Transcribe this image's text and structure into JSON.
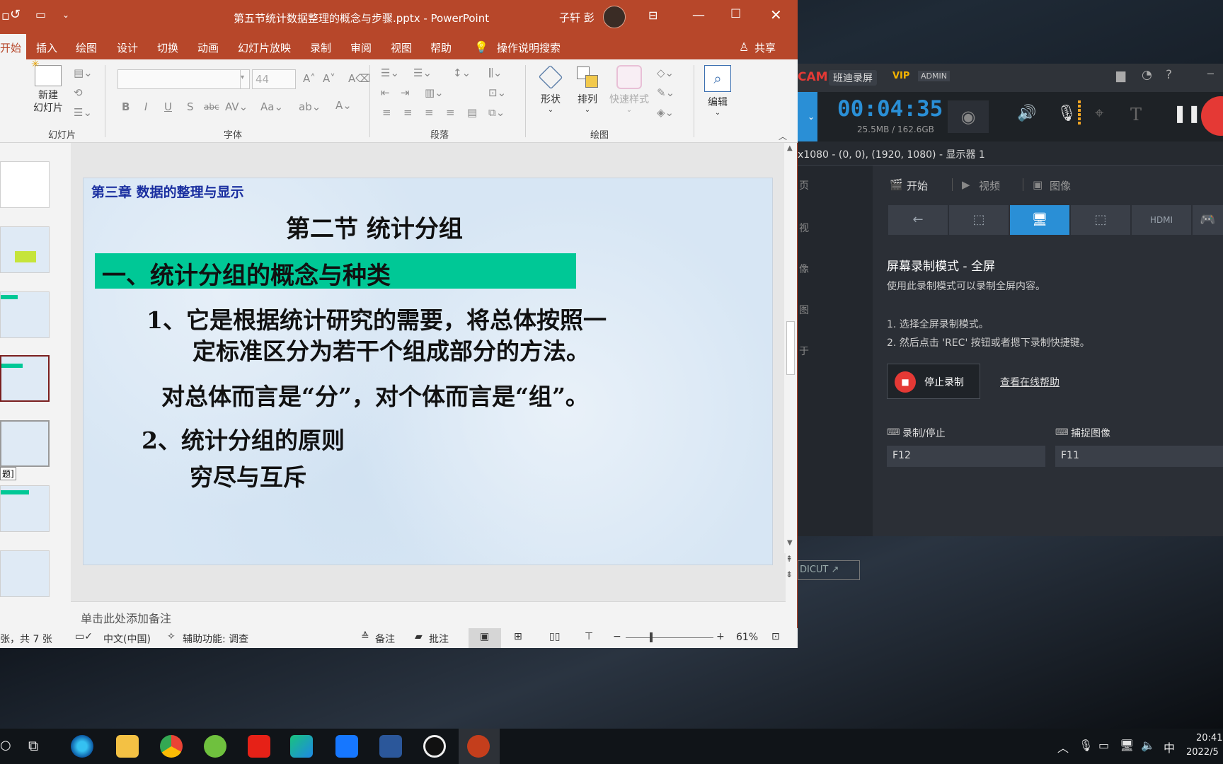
{
  "ppt": {
    "title": "第五节统计数据整理的概念与步骤.pptx  -  PowerPoint",
    "user": "子轩 彭",
    "menu": [
      "开始",
      "插入",
      "绘图",
      "设计",
      "切换",
      "动画",
      "幻灯片放映",
      "录制",
      "审阅",
      "视图",
      "帮助",
      "操作说明搜索",
      "共享"
    ],
    "ribbon": {
      "new_slide": "新建\n幻灯片",
      "slides_group": "幻灯片",
      "font_size": "44",
      "font_group": "字体",
      "para_group": "段落",
      "shape": "形状",
      "arrange": "排列",
      "quick_style": "快速样式",
      "draw_group": "绘图",
      "edit": "编辑"
    },
    "thumb_tag": "题]",
    "slide": {
      "chapter": "第三章  数据的整理与显示",
      "section": "第二节    统计分组",
      "heading": "一、统计分组的概念与种类",
      "p1a": "1、它是根据统计研究的需要，将总体按照一",
      "p1b": "定标准区分为若干个组成部分的方法。",
      "p2": "对总体而言是“分”，对个体而言是“组”。",
      "p3": "2、统计分组的原则",
      "p4": "穷尽与互斥"
    },
    "notes_placeholder": "单击此处添加备注",
    "status": {
      "slide_count": "张，共 7 张",
      "lang": "中文(中国)",
      "access": "辅助功能: 调查",
      "notes": "备注",
      "comments": "批注",
      "zoom": "61%"
    }
  },
  "bandicam": {
    "brand": "CAM",
    "brand_cn": "班迪录屏",
    "vip": "VIP",
    "admin": "ADMIN",
    "timer": "00:04:35",
    "size": "25.5MB / 162.6GB",
    "info": "x1080 - (0, 0), (1920, 1080) - 显示器 1",
    "tabs": [
      "开始",
      "视频",
      "图像"
    ],
    "mode_title": "屏幕录制模式 - 全屏",
    "mode_desc": "使用此录制模式可以录制全屏内容。",
    "step1": "1. 选择全屏录制模式。",
    "step2": "2. 然后点击 'REC' 按钮或者摁下录制快捷键。",
    "stop_label": "停止录制",
    "help_link": "查看在线帮助",
    "hotkey_rec_label": "录制/停止",
    "hotkey_rec": "F12",
    "hotkey_cap_label": "捕捉图像",
    "hotkey_cap": "F11",
    "side": [
      "页",
      "视",
      "像",
      "图",
      "于"
    ],
    "logo": "DICUT ↗"
  },
  "taskbar": {
    "time": "20:41",
    "date": "2022/5",
    "ime": "中"
  },
  "colors": {
    "ppt_accent": "#b7472a",
    "heading_bar": "#00c896",
    "chapter_blue": "#1a2fa0",
    "bandicam_blue": "#2a8fd6",
    "rec_red": "#e53935"
  }
}
